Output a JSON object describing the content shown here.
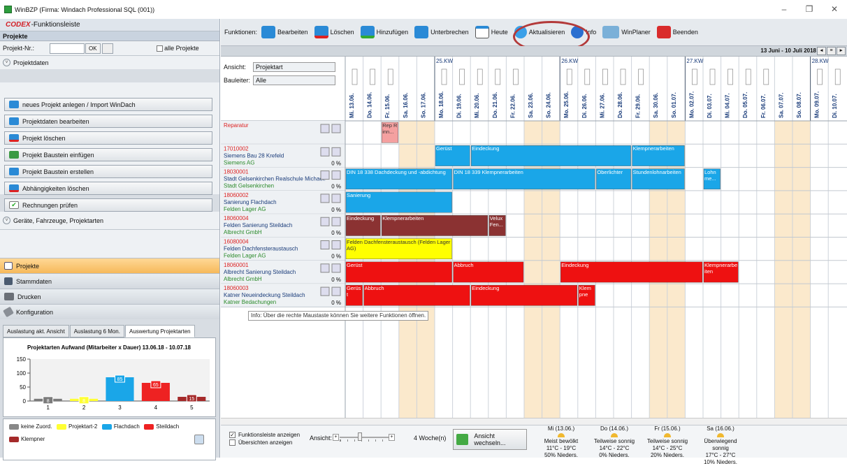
{
  "window": {
    "title": "WinBZP (Firma: Windach Professional SQL  (001))",
    "min": "–",
    "max": "❐",
    "close": "✕"
  },
  "left": {
    "header_brand": "CODEX",
    "header_title": "-Funktionsleiste",
    "section_title": "Projekte",
    "proj_nr_label": "Projekt-Nr.:",
    "ok_label": "OK",
    "all_projects": "alle Projekte",
    "projektdaten": "Projektdaten",
    "actions": [
      "neues Projekt anlegen / Import WinDach",
      "Projektdaten bearbeiten",
      "Projekt löschen",
      "Projekt Baustein einfügen",
      "Projekt Baustein erstellen",
      "Abhängigkeiten löschen",
      "Rechnungen prüfen"
    ],
    "geraete": "Geräte, Fahrzeuge, Projektarten",
    "nav": [
      "Projekte",
      "Stammdaten",
      "Drucken",
      "Konfiguration"
    ],
    "tabs": [
      "Auslastung akt. Ansicht",
      "Auslastung 6 Mon.",
      "Auswertung Projektarten"
    ],
    "legend": [
      "keine Zuord.",
      "Projektart-2",
      "Flachdach",
      "Steildach",
      "Klempner"
    ]
  },
  "chart_data": {
    "type": "bar",
    "title": "Projektarten Aufwand (Mitarbeiter x Dauer) 13.06.18 - 10.07.18",
    "categories": [
      "1",
      "2",
      "3",
      "4",
      "5"
    ],
    "values": [
      8,
      8,
      85,
      65,
      15
    ],
    "labels": [
      "8",
      "8",
      "85",
      "65",
      "15"
    ],
    "colors": [
      "#7a7a7a",
      "#ffff33",
      "#1aa6e8",
      "#ee2222",
      "#a52a2a"
    ],
    "ylim": [
      0,
      150
    ],
    "yticks": [
      "150",
      "100",
      "50",
      "0"
    ]
  },
  "toolbar": {
    "funktionen": "Funktionen:",
    "buttons": [
      "Bearbeiten",
      "Löschen",
      "Hinzufügen",
      "Unterbrechen",
      "Heute",
      "Aktualisieren",
      "Info",
      "WinPlaner",
      "Beenden"
    ]
  },
  "daterange": "13 Juni - 10 Juli 2018",
  "filters": {
    "ansicht_label": "Ansicht:",
    "ansicht_value": "Projektart",
    "bauleiter_label": "Bauleiter:",
    "bauleiter_value": "Alle"
  },
  "weeks": [
    "25.KW",
    "26.KW",
    "27.KW",
    "28.KW"
  ],
  "days": [
    "Mi. 13.06.",
    "Do. 14.06.",
    "Fr. 15.06.",
    "Sa. 16.06.",
    "So. 17.06.",
    "Mo. 18.06.",
    "Di. 19.06.",
    "Mi. 20.06.",
    "Do. 21.06.",
    "Fr. 22.06.",
    "Sa. 23.06.",
    "So. 24.06.",
    "Mo. 25.06.",
    "Di. 26.06.",
    "Mi. 27.06.",
    "Do. 28.06.",
    "Fr. 29.06.",
    "Sa. 30.06.",
    "So. 01.07.",
    "Mo. 02.07.",
    "Di. 03.07.",
    "Mi. 04.07.",
    "Do. 05.07.",
    "Fr. 06.07.",
    "Sa. 07.07.",
    "So. 08.07.",
    "Mo. 09.07.",
    "Di. 10.07."
  ],
  "projects": [
    {
      "nr": "Reparatur",
      "name": "",
      "client": "",
      "pct": ""
    },
    {
      "nr": "17010002",
      "name": "Siemens Bau 28 Krefeld",
      "client": "Siemens AG",
      "pct": "0 %"
    },
    {
      "nr": "18030001",
      "name": "Stadt Gelsenkirchen Realschule Michael:",
      "client": "Stadt Gelsenkirchen",
      "pct": "0 %"
    },
    {
      "nr": "18060002",
      "name": "Sanierung Flachdach",
      "client": "Felden Lager AG",
      "pct": "0 %"
    },
    {
      "nr": "18060004",
      "name": "Felden Sanierung Steildach",
      "client": "Albrecht GmbH",
      "pct": "0 %"
    },
    {
      "nr": "16080004",
      "name": "Felden Dachfensteraustausch",
      "client": "Felden Lager AG",
      "pct": "0 %"
    },
    {
      "nr": "18060001",
      "name": "Albrecht Sanierung Steildach",
      "client": "Albrecht GmbH",
      "pct": "0 %"
    },
    {
      "nr": "18060003",
      "name": "Katner Neueindeckung Steildach",
      "client": "Katner Bedachungen",
      "pct": "0 %"
    }
  ],
  "bars": [
    {
      "row": 0,
      "start": 2,
      "len": 1,
      "label": "Rep Rinn...",
      "color": "#f4a0a0",
      "text": "#333"
    },
    {
      "row": 1,
      "start": 5,
      "len": 2,
      "label": "Gerüst",
      "color": "#1aa6e8",
      "text": "#fff"
    },
    {
      "row": 1,
      "start": 7,
      "len": 9,
      "label": "Eindeckung",
      "color": "#1aa6e8",
      "text": "#fff"
    },
    {
      "row": 1,
      "start": 16,
      "len": 3,
      "label": "Klempnerarbeiten",
      "color": "#1aa6e8",
      "text": "#fff"
    },
    {
      "row": 2,
      "start": 0,
      "len": 6,
      "label": "DIN 18 338 Dachdeckung und -abdichtung",
      "color": "#1aa6e8",
      "text": "#fff"
    },
    {
      "row": 2,
      "start": 6,
      "len": 8,
      "label": "DIN 18 339 Klempnerarbeiten",
      "color": "#1aa6e8",
      "text": "#fff"
    },
    {
      "row": 2,
      "start": 14,
      "len": 2,
      "label": "Oberlichter",
      "color": "#1aa6e8",
      "text": "#fff"
    },
    {
      "row": 2,
      "start": 16,
      "len": 3,
      "label": "Stundenlohnarbeiten",
      "color": "#1aa6e8",
      "text": "#fff"
    },
    {
      "row": 2,
      "start": 20,
      "len": 1,
      "label": "Lohn me...",
      "color": "#1aa6e8",
      "text": "#fff"
    },
    {
      "row": 3,
      "start": 0,
      "len": 6,
      "label": "Sanierung",
      "color": "#1aa6e8",
      "text": "#fff"
    },
    {
      "row": 4,
      "start": 0,
      "len": 2,
      "label": "Eindeckung",
      "color": "#8b3232",
      "text": "#fff"
    },
    {
      "row": 4,
      "start": 2,
      "len": 6,
      "label": "Klempnerarbeiten",
      "color": "#8b3232",
      "text": "#fff"
    },
    {
      "row": 4,
      "start": 8,
      "len": 1,
      "label": "Velux Fen...",
      "color": "#8b3232",
      "text": "#fff"
    },
    {
      "row": 5,
      "start": 0,
      "len": 6,
      "label": "Felden Dachfensteraustausch (Felden Lager AG)",
      "color": "#ffff00",
      "text": "#333"
    },
    {
      "row": 6,
      "start": 0,
      "len": 6,
      "label": "Gerüst",
      "color": "#ee1111",
      "text": "#fff"
    },
    {
      "row": 6,
      "start": 6,
      "len": 4,
      "label": "Abbruch",
      "color": "#ee1111",
      "text": "#fff"
    },
    {
      "row": 6,
      "start": 12,
      "len": 8,
      "label": "Eindeckung",
      "color": "#ee1111",
      "text": "#fff"
    },
    {
      "row": 6,
      "start": 20,
      "len": 2,
      "label": "Klempnerarbeiten",
      "color": "#ee1111",
      "text": "#fff"
    },
    {
      "row": 7,
      "start": 0,
      "len": 1,
      "label": "Gerüs t",
      "color": "#ee1111",
      "text": "#fff"
    },
    {
      "row": 7,
      "start": 1,
      "len": 6,
      "label": "Abbruch",
      "color": "#ee1111",
      "text": "#fff"
    },
    {
      "row": 7,
      "start": 7,
      "len": 6,
      "label": "Eindeckung",
      "color": "#ee1111",
      "text": "#fff"
    },
    {
      "row": 7,
      "start": 13,
      "len": 1,
      "label": "Klem pne",
      "color": "#ee1111",
      "text": "#fff"
    }
  ],
  "tooltip": "Info: Über die rechte Maustaste können Sie weitere Funktionen öffnen.",
  "bottom": {
    "cb1": "Funktionsleiste anzeigen",
    "cb2": "Übersichten anzeigen",
    "ansicht": "Ansicht:",
    "weeks": "4 Woche(n)",
    "switch": "Ansicht wechseln...",
    "weather": [
      {
        "day": "Mi (13.06.)",
        "desc": "Meist bewölkt",
        "temp": "11°C - 19°C",
        "rain": "50% Nieders."
      },
      {
        "day": "Do (14.06.)",
        "desc": "Teilweise sonnig",
        "temp": "14°C - 22°C",
        "rain": "0% Nieders."
      },
      {
        "day": "Fr (15.06.)",
        "desc": "Teilweise sonnig",
        "temp": "14°C - 25°C",
        "rain": "20% Nieders."
      },
      {
        "day": "Sa (16.06.)",
        "desc": "Überwiegend sonnig",
        "temp": "17°C - 27°C",
        "rain": "10% Nieders."
      }
    ]
  }
}
